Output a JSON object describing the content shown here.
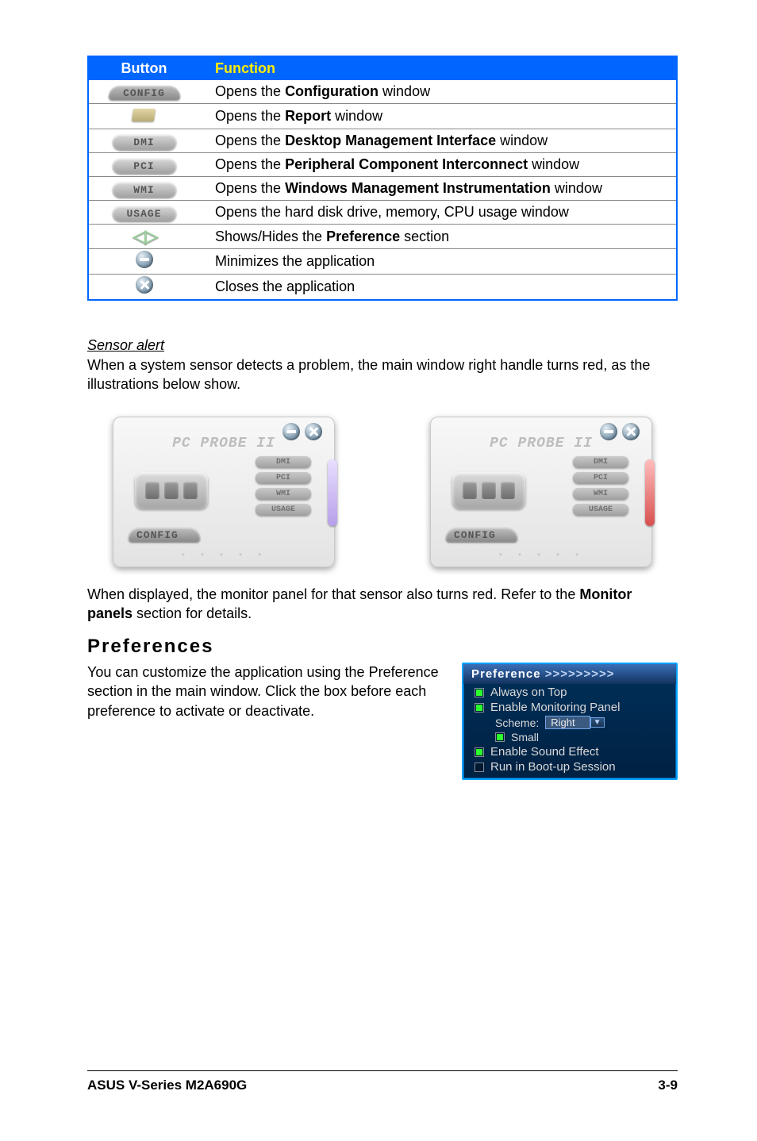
{
  "table": {
    "headers": {
      "button": "Button",
      "function": "Function"
    },
    "rows": [
      {
        "btn_type": "tab",
        "btn_label": "CONFIG",
        "func_pre": "Opens the ",
        "func_bold": "Configuration",
        "func_post": " window"
      },
      {
        "btn_type": "folder",
        "btn_label": "",
        "func_pre": "Opens the ",
        "func_bold": "Report",
        "func_post": " window"
      },
      {
        "btn_type": "pill",
        "btn_label": "DMI",
        "func_pre": "Opens the ",
        "func_bold": "Desktop Management Interface",
        "func_post": " window"
      },
      {
        "btn_type": "pill",
        "btn_label": "PCI",
        "func_pre": "Opens the ",
        "func_bold": "Peripheral Component Interconnect",
        "func_post": " window"
      },
      {
        "btn_type": "pill",
        "btn_label": "WMI",
        "func_pre": "Opens the ",
        "func_bold": "Windows Management Instrumentation",
        "func_post": " window"
      },
      {
        "btn_type": "pill",
        "btn_label": "USAGE",
        "func_pre": "",
        "func_bold": "",
        "func_post": "Opens the hard disk drive, memory, CPU usage window"
      },
      {
        "btn_type": "arrows",
        "btn_label": "◁ ▷",
        "func_pre": "Shows/Hides the ",
        "func_bold": "Preference",
        "func_post": " section"
      },
      {
        "btn_type": "minus",
        "btn_label": "",
        "func_pre": "",
        "func_bold": "",
        "func_post": "Minimizes the application"
      },
      {
        "btn_type": "close",
        "btn_label": "",
        "func_pre": "",
        "func_bold": "",
        "func_post": "Closes the application"
      }
    ]
  },
  "sensor": {
    "heading": "Sensor alert",
    "para": "When a system sensor detects a problem, the main window right handle turns red, as the illustrations below show."
  },
  "probe_label": "PC PROBE II",
  "probe_chips": [
    "DMI",
    "PCI",
    "WMI",
    "USAGE"
  ],
  "probe_config": "CONFIG",
  "after_probe": {
    "pre": "When displayed, the monitor panel for that sensor also turns red. Refer to the ",
    "bold": "Monitor panels",
    "post": " section for details."
  },
  "preferences": {
    "heading": "Preferences",
    "para": "You can customize the application using the Preference section in the main window. Click the box before each preference to activate or deactivate.",
    "panel": {
      "title": "Preference",
      "chev": " >>>>>>>>>",
      "items": {
        "always": "Always on Top",
        "enable_panel": "Enable Monitoring Panel",
        "scheme_label": "Scheme:",
        "scheme_value": "Right",
        "small": "Small",
        "sound": "Enable Sound Effect",
        "bootup": "Run in Boot-up Session"
      }
    }
  },
  "footer": {
    "left": "ASUS V-Series M2A690G",
    "right": "3-9"
  }
}
